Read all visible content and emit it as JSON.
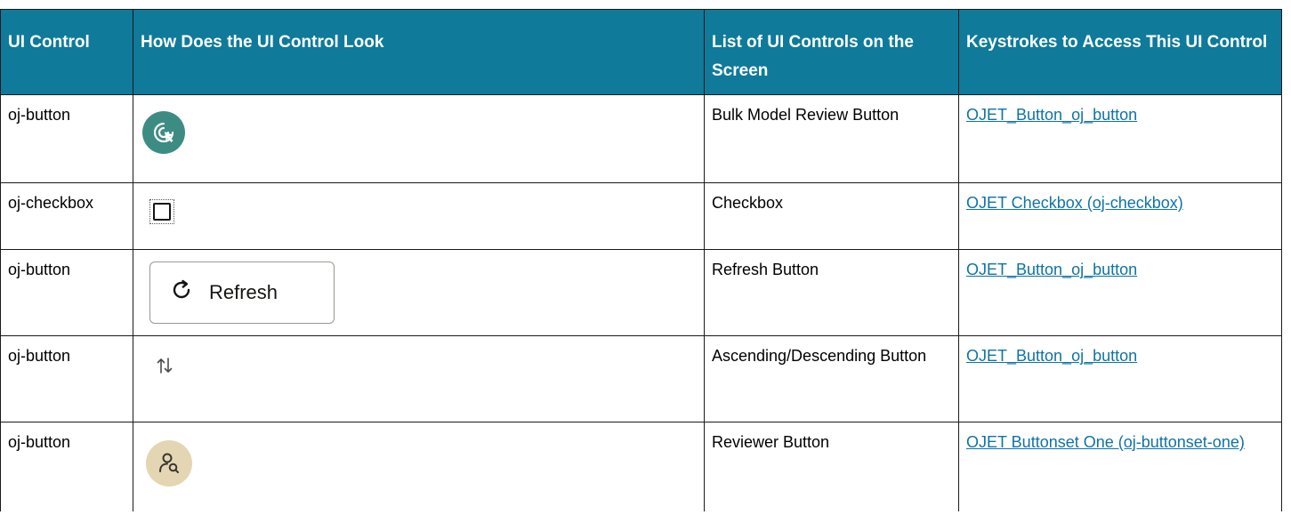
{
  "headers": {
    "col1": "UI Control",
    "col2": "How Does the UI Control Look",
    "col3": "List of UI Controls on the Screen",
    "col4": "Keystrokes to Access This UI Control"
  },
  "rows": [
    {
      "control": "oj-button",
      "icon": "bulk-model-review-icon",
      "list": "Bulk Model Review Button",
      "keystrokes": "OJET_Button_oj_button"
    },
    {
      "control": "oj-checkbox",
      "icon": "checkbox-icon",
      "list": "Checkbox",
      "keystrokes": "OJET Checkbox (oj-checkbox)"
    },
    {
      "control": "oj-button",
      "icon": "refresh-icon",
      "button_label": "Refresh",
      "list": "Refresh Button",
      "keystrokes": "OJET_Button_oj_button"
    },
    {
      "control": "oj-button",
      "icon": "sort-arrows-icon",
      "list": "Ascending/Descending Button",
      "keystrokes": "OJET_Button_oj_button"
    },
    {
      "control": "oj-button",
      "icon": "reviewer-search-icon",
      "list": "Reviewer Button",
      "keystrokes": "OJET Buttonset One (oj-buttonset-one)"
    }
  ],
  "colors": {
    "header_bg": "#0f7a9a",
    "link": "#0f73a5",
    "teal_icon_bg": "#3d8c84",
    "beige_icon_bg": "#e4d6b3"
  }
}
